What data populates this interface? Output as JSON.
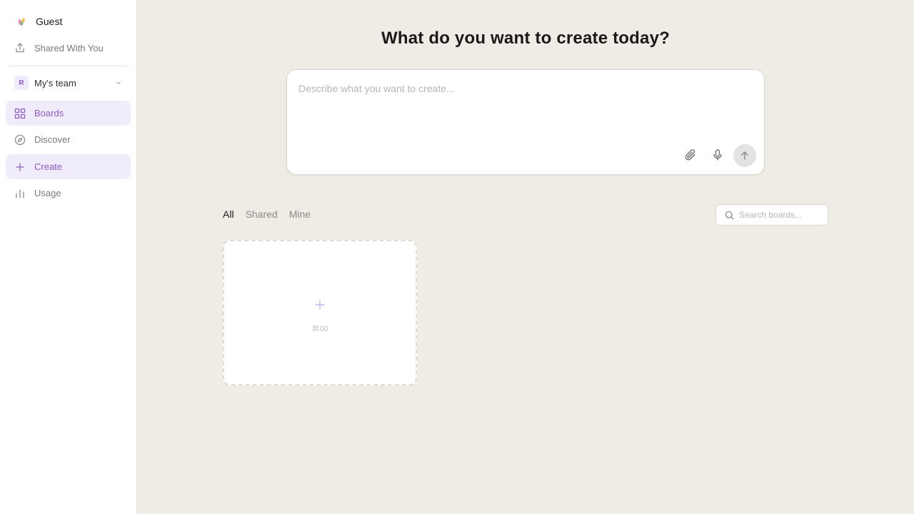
{
  "sidebar": {
    "user_name": "Guest",
    "shared_link": "Shared With You",
    "team": {
      "avatar_letter": "R",
      "name": "My's team"
    },
    "nav": [
      {
        "label": "Boards",
        "icon": "grid-icon",
        "active": true
      },
      {
        "label": "Discover",
        "icon": "compass-icon",
        "active": false
      },
      {
        "label": "Create",
        "icon": "plus-icon",
        "active": true
      },
      {
        "label": "Usage",
        "icon": "bar-chart-icon",
        "active": false
      }
    ]
  },
  "main": {
    "title": "What do you want to create today?",
    "prompt": {
      "placeholder": "Describe what you want to create...",
      "value": ""
    },
    "filters": [
      "All",
      "Shared",
      "Mine"
    ],
    "active_filter": "All",
    "search": {
      "placeholder": "Search boards...",
      "value": ""
    },
    "new_board_card": {
      "shortcut": "⌘00"
    }
  },
  "colors": {
    "accent": "#8b5bc8",
    "accent_bg": "#f1ecfb",
    "page_bg": "#efebe5"
  }
}
